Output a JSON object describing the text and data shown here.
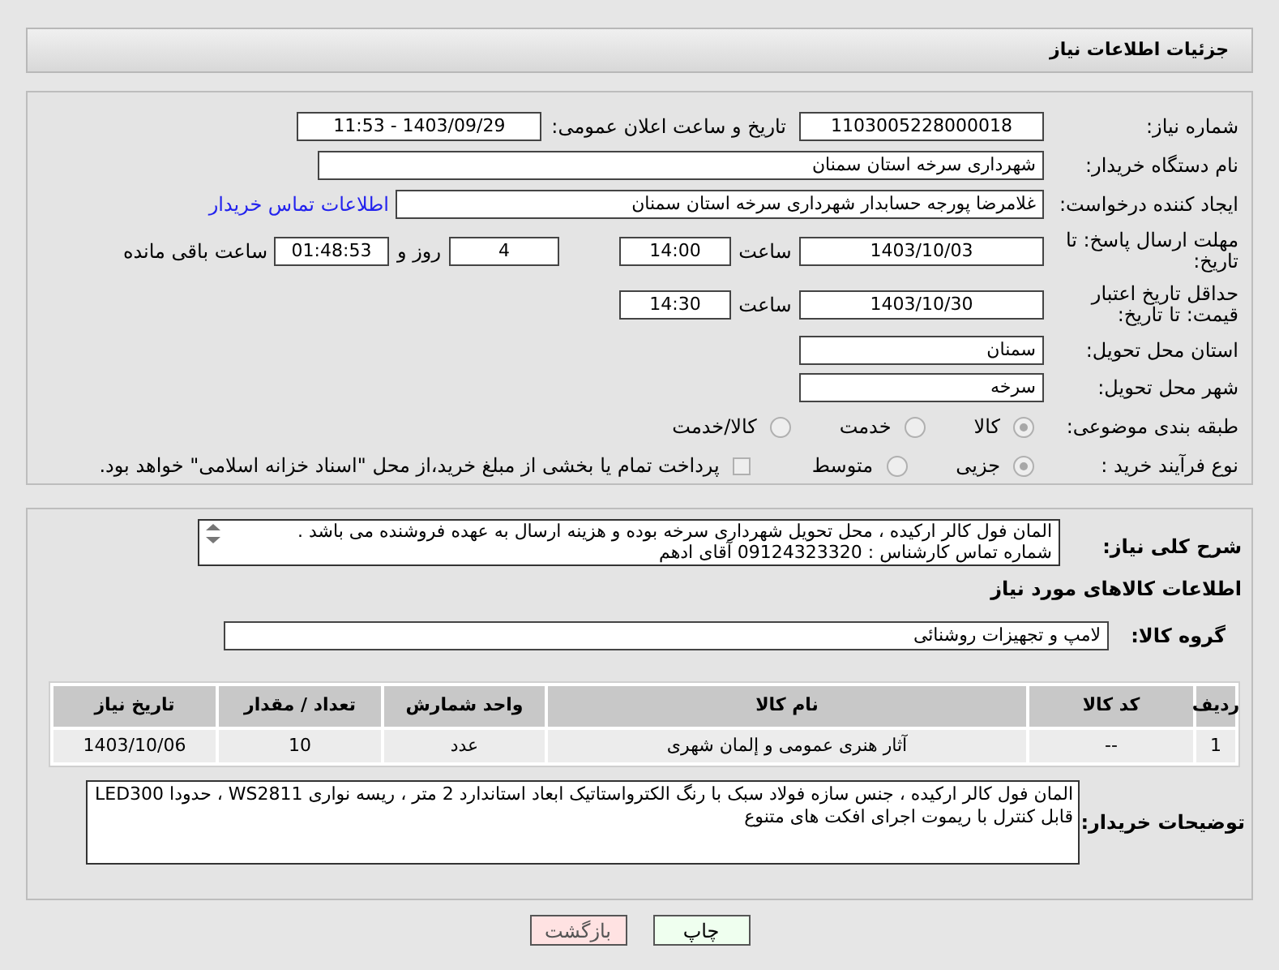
{
  "header": {
    "title": "جزئیات اطلاعات نیاز"
  },
  "details": {
    "need_number": {
      "label": "شماره نیاز:",
      "value": "1103005228000018"
    },
    "announce": {
      "label": "تاریخ و ساعت اعلان عمومی:",
      "value": "1403/09/29 - 11:53"
    },
    "buyer": {
      "label": "نام دستگاه خریدار:",
      "value": "شهرداری سرخه استان سمنان"
    },
    "requester": {
      "label": "ایجاد کننده درخواست:",
      "value": "غلامرضا پورجه حسابدار شهرداری سرخه استان سمنان",
      "link": "اطلاعات تماس خریدار"
    },
    "deadline": {
      "label": "مهلت ارسال پاسخ: تا تاریخ:",
      "date": "1403/10/03",
      "time_label": "ساعت",
      "time": "14:00",
      "days": "4",
      "days_label": "روز و",
      "remaining": "01:48:53",
      "remaining_label": "ساعت باقی مانده"
    },
    "validity": {
      "label": "حداقل تاریخ اعتبار قیمت: تا تاریخ:",
      "date": "1403/10/30",
      "time_label": "ساعت",
      "time": "14:30"
    },
    "province": {
      "label": "استان محل تحویل:",
      "value": "سمنان"
    },
    "city": {
      "label": "شهر محل تحویل:",
      "value": "سرخه"
    },
    "category": {
      "label": "طبقه بندی موضوعی:",
      "options": [
        {
          "label": "کالا",
          "selected": true
        },
        {
          "label": "خدمت",
          "selected": false
        },
        {
          "label": "کالا/خدمت",
          "selected": false
        }
      ]
    },
    "process": {
      "label": "نوع فرآیند خرید :",
      "options": [
        {
          "label": "جزیی",
          "selected": true
        },
        {
          "label": "متوسط",
          "selected": false
        }
      ],
      "payment": {
        "label": "پرداخت تمام یا بخشی از مبلغ خرید،از محل \"اسناد خزانه اسلامی\" خواهد بود.",
        "checked": false
      }
    }
  },
  "need": {
    "description_label": "شرح کلی نیاز:",
    "description": "المان فول کالر ارکیده ، محل تحویل شهرداری سرخه بوده و هزینه ارسال به عهده فروشنده می باشد .\nشماره تماس کارشناس : 09124323320 آقای ادهم",
    "goods_heading": "اطلاعات کالاهای مورد نیاز",
    "group": {
      "label": "گروه کالا:",
      "value": "لامپ و تجهیزات روشنائی"
    },
    "table": {
      "columns": [
        "ردیف",
        "کد کالا",
        "نام کالا",
        "واحد شمارش",
        "تعداد / مقدار",
        "تاریخ نیاز"
      ],
      "rows": [
        [
          "1",
          "--",
          "آثار هنری عمومی و إلمان شهری",
          "عدد",
          "10",
          "1403/10/06"
        ]
      ]
    },
    "notes_label": "توضیحات خریدار:",
    "notes": "المان فول کالر ارکیده ، جنس سازه فولاد سبک با رنگ الکترواستاتیک ابعاد استاندارد 2 متر ، ریسه نواری WS2811 ، حدودا LED300 قابل کنترل با ریموت اجرای افکت های متنوع"
  },
  "buttons": [
    {
      "label": "چاپ",
      "kind": "print"
    },
    {
      "label": "بازگشت",
      "kind": "back"
    }
  ]
}
